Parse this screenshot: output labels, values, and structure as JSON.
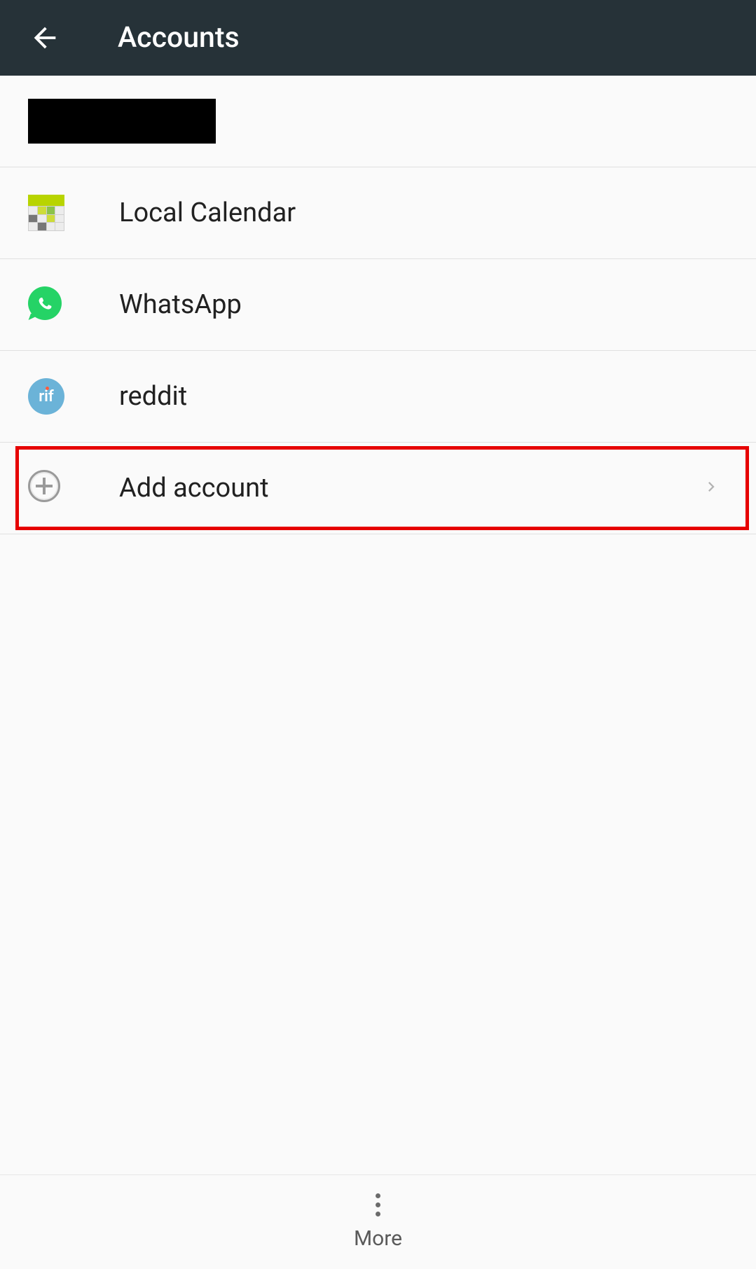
{
  "header": {
    "title": "Accounts"
  },
  "accounts": [
    {
      "label": "",
      "icon": "redacted"
    },
    {
      "label": "Local Calendar",
      "icon": "calendar"
    },
    {
      "label": "WhatsApp",
      "icon": "whatsapp"
    },
    {
      "label": "reddit",
      "icon": "rif"
    }
  ],
  "add_account": {
    "label": "Add account"
  },
  "footer": {
    "more_label": "More"
  },
  "icons": {
    "rif_text": "rif"
  }
}
